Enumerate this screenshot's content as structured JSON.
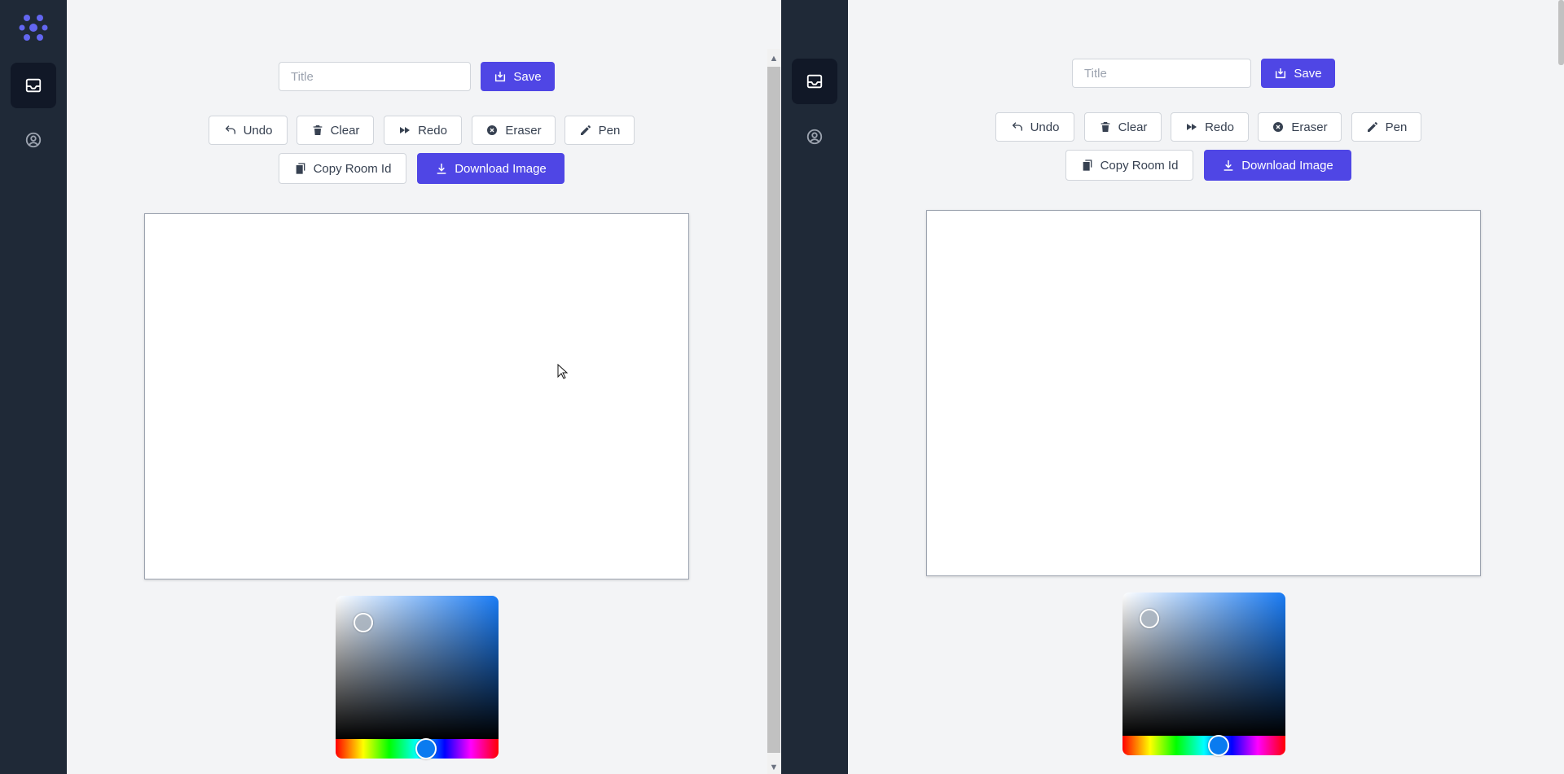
{
  "colors": {
    "sidebar_bg": "#1f2937",
    "sidebar_active": "#111827",
    "accent": "#4f46e5",
    "page_bg": "#f3f4f6",
    "picker_color": "#1a7cf5"
  },
  "left_panel": {
    "title_placeholder": "Title",
    "save_label": "Save",
    "toolbar": {
      "undo": "Undo",
      "clear": "Clear",
      "redo": "Redo",
      "eraser": "Eraser",
      "pen": "Pen",
      "copy_room_id": "Copy Room Id",
      "download_image": "Download Image"
    }
  },
  "right_panel": {
    "title_placeholder": "Title",
    "save_label": "Save",
    "toolbar": {
      "undo": "Undo",
      "clear": "Clear",
      "redo": "Redo",
      "eraser": "Eraser",
      "pen": "Pen",
      "copy_room_id": "Copy Room Id",
      "download_image": "Download Image"
    }
  },
  "sidebar": {
    "items": [
      {
        "icon": "inbox-icon",
        "active": true
      },
      {
        "icon": "user-circle-icon",
        "active": false
      }
    ]
  }
}
